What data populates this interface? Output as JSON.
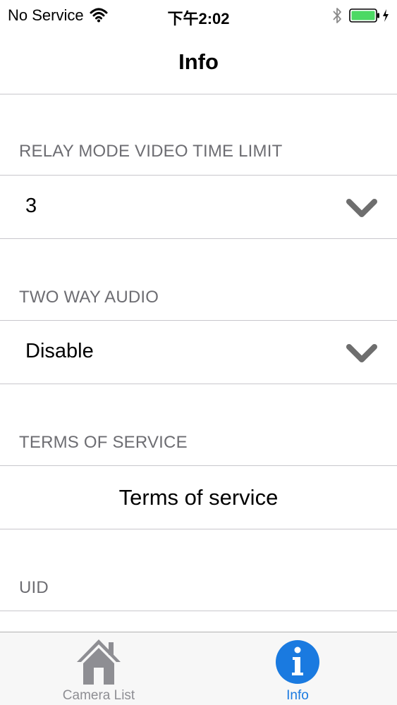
{
  "status_bar": {
    "carrier": "No Service",
    "time": "下午2:02",
    "battery_color": "#4cd964"
  },
  "nav": {
    "title": "Info"
  },
  "sections": {
    "relay": {
      "header": "RELAY MODE VIDEO TIME LIMIT",
      "value": "3"
    },
    "audio": {
      "header": "TWO WAY AUDIO",
      "value": "Disable"
    },
    "terms": {
      "header": "TERMS OF SERVICE",
      "button_label": "Terms of service"
    },
    "uid": {
      "header": "UID"
    }
  },
  "tab_bar": {
    "tabs": [
      {
        "label": "Camera List",
        "icon": "house-icon",
        "selected": false
      },
      {
        "label": "Info",
        "icon": "info-icon",
        "selected": true
      }
    ],
    "active_color": "#1a7ae0",
    "inactive_color": "#8e8e93"
  }
}
